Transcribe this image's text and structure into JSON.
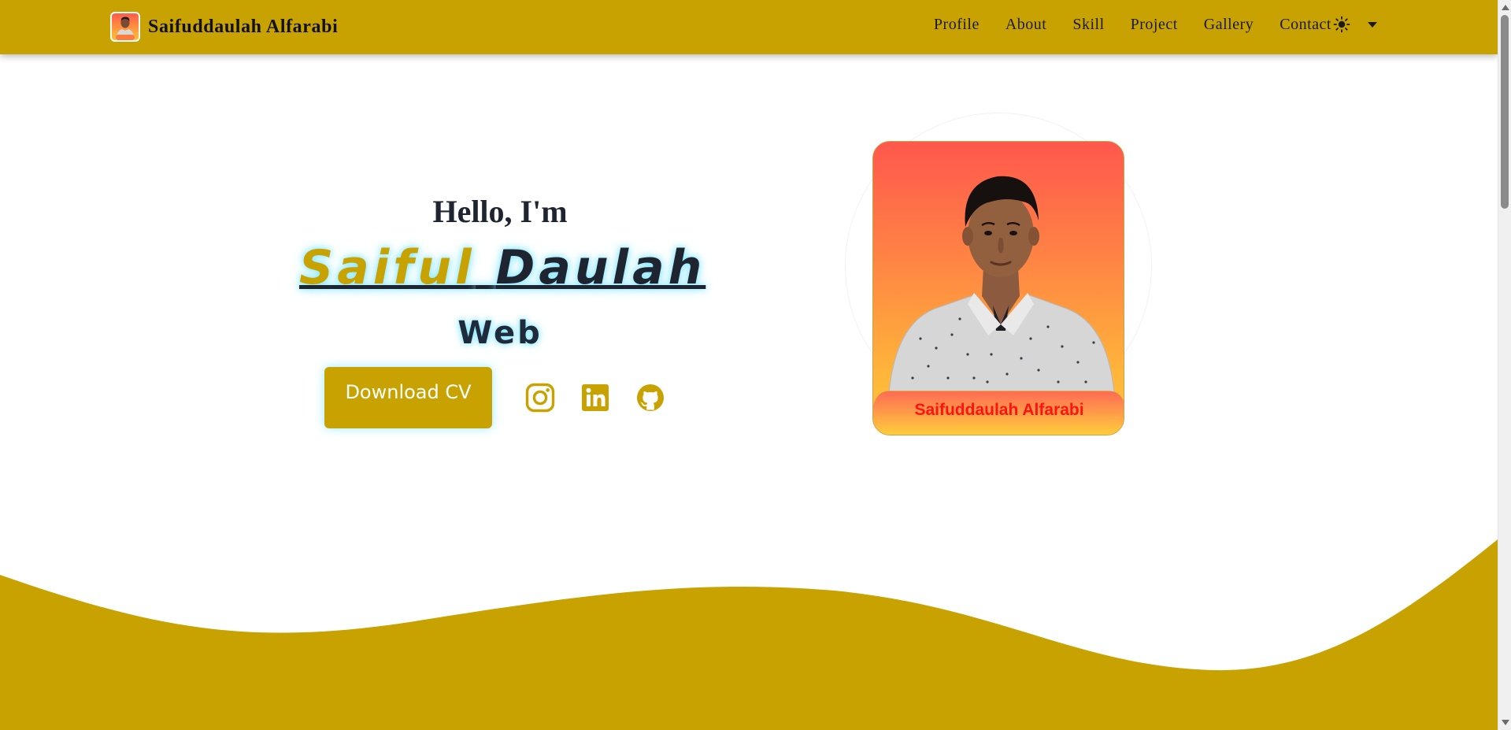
{
  "brand": {
    "name": "Saifuddaulah Alfarabi",
    "avatar_alt": "profile photo thumbnail"
  },
  "nav": {
    "items": [
      "Profile",
      "About",
      "Skill",
      "Project",
      "Gallery",
      "Contact"
    ],
    "theme_icon": "sun-icon",
    "theme_dropdown_icon": "caret-down-icon"
  },
  "hero": {
    "greeting": "Hello, I'm",
    "name_first": "Saiful",
    "name_last": "Daulah",
    "role": "Web",
    "download_label": "Download CV",
    "socials": [
      "instagram-icon",
      "linkedin-icon",
      "github-icon"
    ]
  },
  "profile_card": {
    "label": "Saifuddaulah Alfarabi"
  },
  "colors": {
    "accent": "#c8a200",
    "text_dark": "#1f2530",
    "glow": "#78e6ff",
    "card_label_text": "#ff1212"
  }
}
